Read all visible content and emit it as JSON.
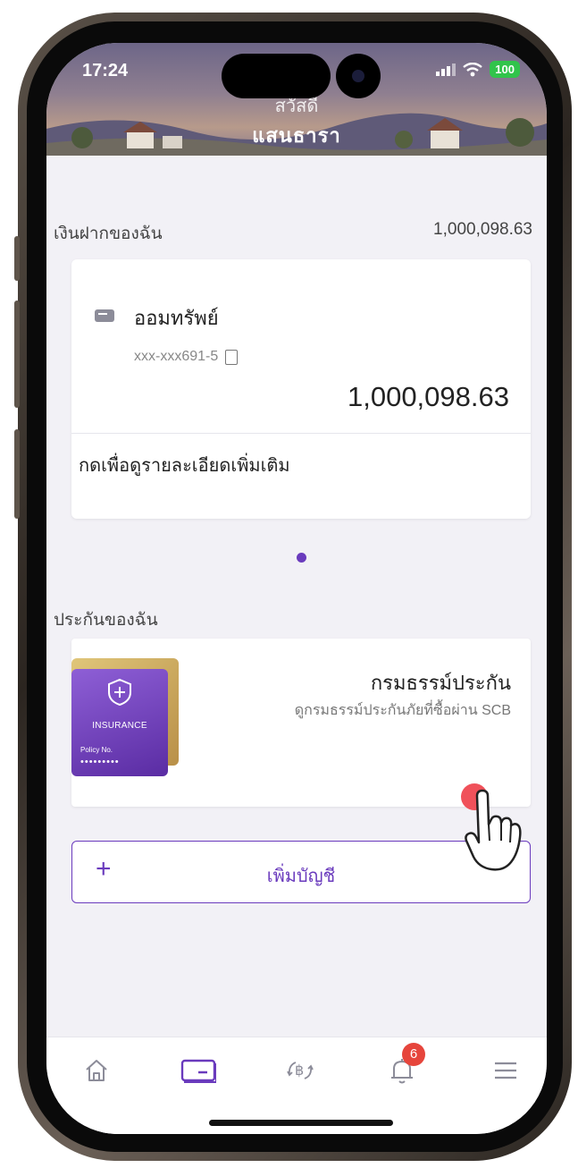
{
  "status": {
    "time": "17:24",
    "battery": "100"
  },
  "header": {
    "greeting": "สวัสดี",
    "name": "แสนธารา"
  },
  "deposits": {
    "section_title": "เงินฝากของฉัน",
    "total": "1,000,098.63",
    "account": {
      "type": "ออมทรัพย์",
      "number": "xxx-xxx691-5",
      "balance": "1,000,098.63",
      "more_label": "กดเพื่อดูรายละเอียดเพิ่มเติม"
    }
  },
  "insurance": {
    "section_title": "ประกันของฉัน",
    "card_title": "กรมธรรม์ประกัน",
    "card_subtitle": "ดูกรมธรรม์ประกันภัยที่ซื้อผ่าน SCB",
    "visual": {
      "label": "INSURANCE",
      "policy_label": "Policy No.",
      "policy_mask": "•••••••••"
    }
  },
  "add_account": {
    "label": "เพิ่มบัญชี",
    "plus": "+"
  },
  "tabbar": {
    "items": [
      {
        "icon": "home-icon"
      },
      {
        "icon": "account-card-icon",
        "active": true
      },
      {
        "icon": "transfer-baht-icon"
      },
      {
        "icon": "bell-icon",
        "badge": "6"
      },
      {
        "icon": "menu-icon"
      }
    ]
  },
  "colors": {
    "accent": "#6a3bbd",
    "badge": "#e6453c",
    "tap": "#f0515a"
  }
}
